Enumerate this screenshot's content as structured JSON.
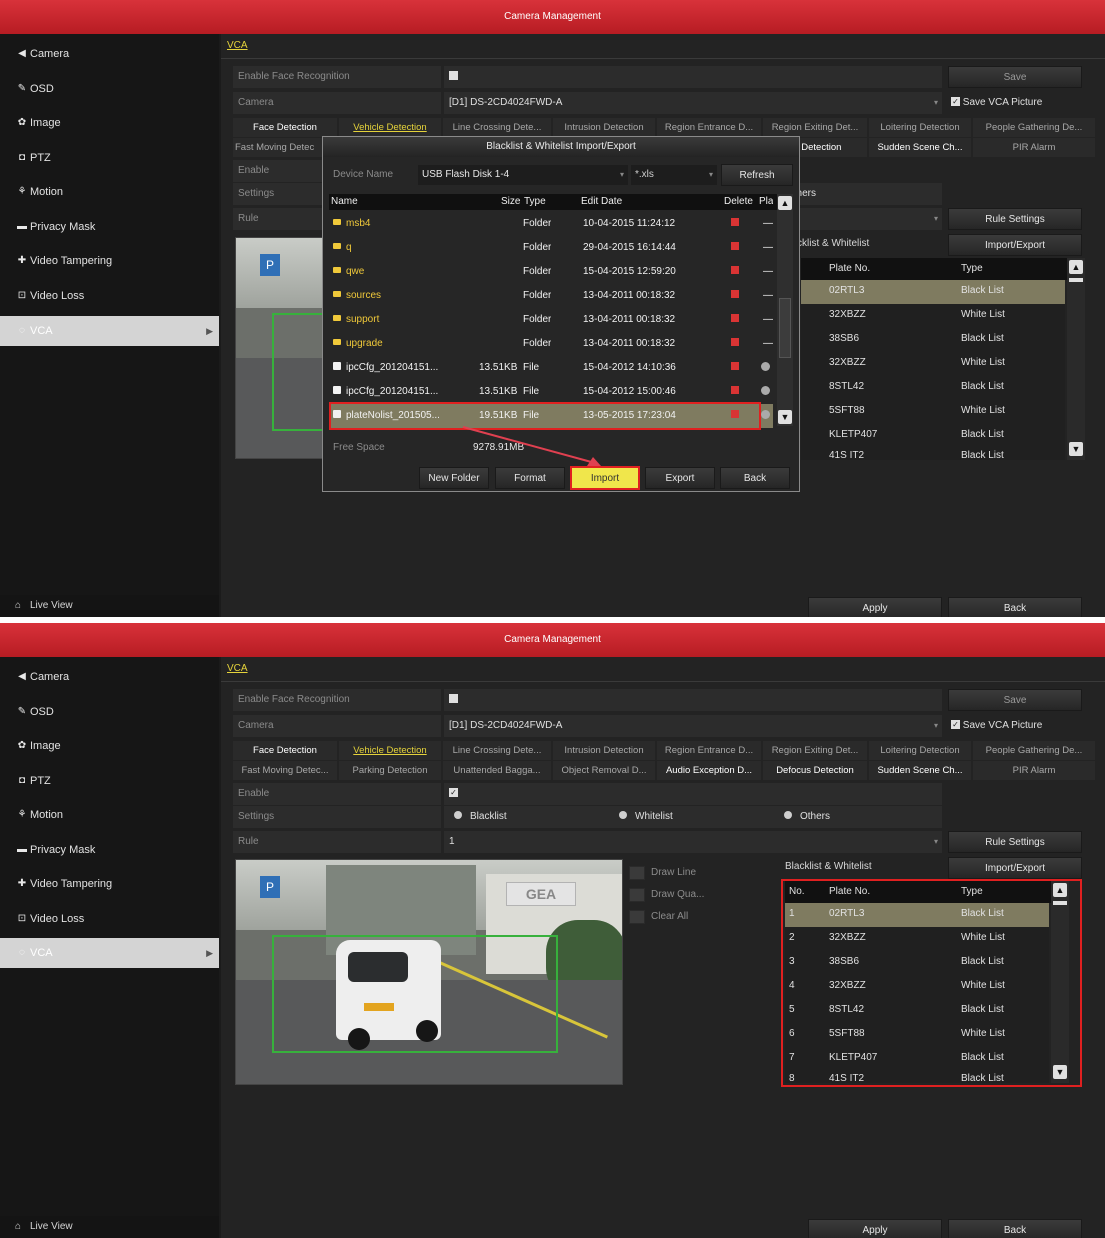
{
  "window": {
    "title": "Camera Management"
  },
  "sidebar": {
    "items": [
      {
        "label": "Camera",
        "icon": "camera-icon",
        "glyph": "◀"
      },
      {
        "label": "OSD",
        "icon": "pencil-icon",
        "glyph": "✎"
      },
      {
        "label": "Image",
        "icon": "image-settings-icon",
        "glyph": "✿"
      },
      {
        "label": "PTZ",
        "icon": "ptz-icon",
        "glyph": "◘"
      },
      {
        "label": "Motion",
        "icon": "motion-icon",
        "glyph": "⚘"
      },
      {
        "label": "Privacy Mask",
        "icon": "privacy-mask-icon",
        "glyph": "▬"
      },
      {
        "label": "Video Tampering",
        "icon": "tampering-icon",
        "glyph": "✚"
      },
      {
        "label": "Video Loss",
        "icon": "video-loss-icon",
        "glyph": "⊡"
      },
      {
        "label": "VCA",
        "icon": "vca-icon",
        "glyph": "◌"
      }
    ],
    "live_view": "Live View"
  },
  "vca_tab": "VCA",
  "form": {
    "enable_face_label": "Enable Face Recognition",
    "camera_label": "Camera",
    "camera_value": "[D1] DS-2CD4024FWD-A",
    "save_vca_picture": "Save VCA Picture",
    "save": "Save",
    "enable_label": "Enable",
    "settings_label": "Settings",
    "rule_label": "Rule",
    "rule_value": "1",
    "rule_settings": "Rule Settings",
    "import_export": "Import/Export",
    "settings_options": [
      "Blacklist",
      "Whitelist",
      "Others"
    ],
    "others_partial": "Others"
  },
  "tabs_row1": [
    "Face Detection",
    "Vehicle Detection",
    "Line Crossing Dete...",
    "Intrusion Detection",
    "Region Entrance D...",
    "Region Exiting Det...",
    "Loitering Detection",
    "People Gathering De..."
  ],
  "tabs_row2": [
    "Fast Moving Detec...",
    "Parking Detection",
    "Unattended Bagga...",
    "Object Removal D...",
    "Audio Exception D...",
    "Defocus Detection",
    "Sudden Scene Ch...",
    "PIR Alarm"
  ],
  "tabs_row1_partial": {
    "line_crossing": "Line Crossing Dete...",
    "region_exiting": "Region Exiting Det..."
  },
  "tabs_row2_partial": {
    "fast_moving": "Fast Moving Detec",
    "defocus": "us Detection"
  },
  "draw": {
    "draw_line": "Draw Line",
    "draw_quad": "Draw Qua...",
    "clear_all": "Clear All"
  },
  "camera_image": {
    "sign": "P",
    "banner": "GEA"
  },
  "bw": {
    "title": "Blacklist & Whitelist",
    "title_partial": "cklist & Whitelist",
    "headers": [
      "No.",
      "Plate No.",
      "Type"
    ],
    "rows": [
      {
        "no": "1",
        "plate": "02RTL3",
        "type": "Black List"
      },
      {
        "no": "2",
        "plate": "32XBZZ",
        "type": "White List"
      },
      {
        "no": "3",
        "plate": "38SB6",
        "type": "Black List"
      },
      {
        "no": "4",
        "plate": "32XBZZ",
        "type": "White List"
      },
      {
        "no": "5",
        "plate": "8STL42",
        "type": "Black List"
      },
      {
        "no": "6",
        "plate": "5SFT88",
        "type": "White List"
      },
      {
        "no": "7",
        "plate": "KLETP407",
        "type": "Black List"
      },
      {
        "no": "8",
        "plate": "41S IT2",
        "type": "Black List"
      }
    ]
  },
  "footer": {
    "apply": "Apply",
    "back": "Back"
  },
  "dialog": {
    "title": "Blacklist & Whitelist Import/Export",
    "device_name_label": "Device Name",
    "device_name_value": "USB Flash Disk 1-4",
    "file_filter": "*.xls",
    "refresh": "Refresh",
    "headers": [
      "Name",
      "Size",
      "Type",
      "Edit Date",
      "Delete",
      "Play"
    ],
    "rows": [
      {
        "name": "msb4",
        "size": "",
        "type": "Folder",
        "date": "10-04-2015 11:24:12",
        "kind": "folder"
      },
      {
        "name": "q",
        "size": "",
        "type": "Folder",
        "date": "29-04-2015 16:14:44",
        "kind": "folder"
      },
      {
        "name": "qwe",
        "size": "",
        "type": "Folder",
        "date": "15-04-2015 12:59:20",
        "kind": "folder"
      },
      {
        "name": "sources",
        "size": "",
        "type": "Folder",
        "date": "13-04-2011 00:18:32",
        "kind": "folder"
      },
      {
        "name": "support",
        "size": "",
        "type": "Folder",
        "date": "13-04-2011 00:18:32",
        "kind": "folder"
      },
      {
        "name": "upgrade",
        "size": "",
        "type": "Folder",
        "date": "13-04-2011 00:18:32",
        "kind": "folder"
      },
      {
        "name": "ipcCfg_201204151...",
        "size": "13.51KB",
        "type": "File",
        "date": "15-04-2012 14:10:36",
        "kind": "file"
      },
      {
        "name": "ipcCfg_201204151...",
        "size": "13.51KB",
        "type": "File",
        "date": "15-04-2012 15:00:46",
        "kind": "file"
      },
      {
        "name": "plateNolist_201505...",
        "size": "19.51KB",
        "type": "File",
        "date": "13-05-2015 17:23:04",
        "kind": "file"
      }
    ],
    "free_space_label": "Free Space",
    "free_space_value": "9278.91MB",
    "buttons": [
      "New Folder",
      "Format",
      "Import",
      "Export",
      "Back"
    ]
  },
  "colors": {
    "title_red": "#c8262d",
    "accent_yellow": "#e5d33b",
    "highlight_red": "#e02020",
    "selected_row": "#7f7b60"
  }
}
